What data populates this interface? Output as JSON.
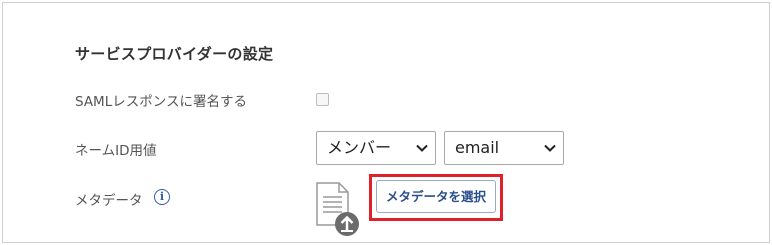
{
  "section": {
    "title": "サービスプロバイダーの設定"
  },
  "saml": {
    "label": "SAMLレスポンスに署名する",
    "checked": false
  },
  "nameid": {
    "label": "ネームID用値",
    "type_select": "メンバー",
    "attribute_select": "email"
  },
  "metadata": {
    "label": "メタデータ",
    "info_icon": "info-icon",
    "file_icon": "document-upload-icon",
    "button_label": "メタデータを選択"
  },
  "colors": {
    "highlight_border": "#e0202a",
    "button_text": "#2b4e8c",
    "info_icon": "#2f5ea8"
  }
}
